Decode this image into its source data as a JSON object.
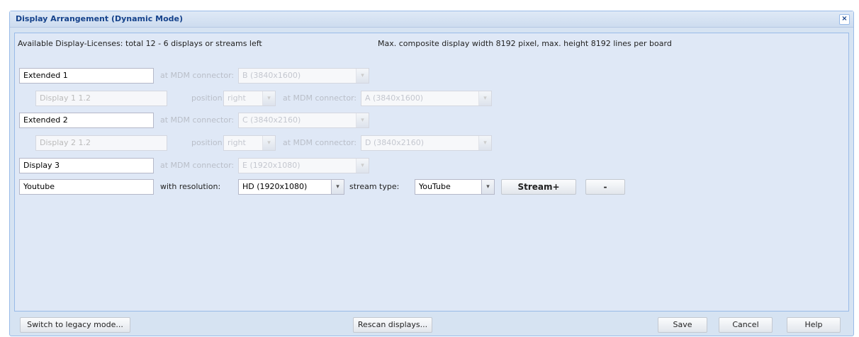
{
  "dialog": {
    "title": "Display Arrangement (Dynamic Mode)",
    "close_symbol": "×",
    "licenses_text": "Available Display-Licenses: total 12 - 6 displays or streams left",
    "max_text": "Max. composite display width 8192 pixel, max. height 8192 lines per board"
  },
  "labels": {
    "at_mdm": "at MDM connector:",
    "position": "position:",
    "with_resolution": "with resolution:",
    "stream_type": "stream type:"
  },
  "rows": {
    "extended1": {
      "name": "Extended 1",
      "connector": "B (3840x1600)"
    },
    "sub1": {
      "name": "Display 1 1.2",
      "position": "right",
      "connector": "A (3840x1600)"
    },
    "extended2": {
      "name": "Extended 2",
      "connector": "C (3840x2160)"
    },
    "sub2": {
      "name": "Display 2 1.2",
      "position": "right",
      "connector": "D (3840x2160)"
    },
    "display3": {
      "name": "Display 3",
      "connector": "E (1920x1080)"
    },
    "youtube": {
      "name": "Youtube",
      "resolution": "HD (1920x1080)",
      "stream_type": "YouTube"
    }
  },
  "buttons": {
    "stream_plus": "Stream+",
    "minus": "-",
    "legacy": "Switch to legacy mode...",
    "rescan": "Rescan displays...",
    "save": "Save",
    "cancel": "Cancel",
    "help": "Help"
  },
  "icons": {
    "dropdown": "chevron-down-icon",
    "close": "close-icon"
  }
}
